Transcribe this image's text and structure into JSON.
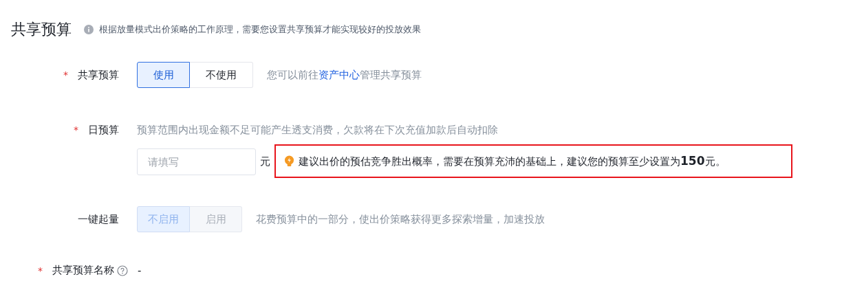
{
  "title": "共享预算",
  "title_hint": "根据放量模式出价策略的工作原理，需要您设置共享预算才能实现较好的投放效果",
  "fields": [
    {
      "kind": "segmented",
      "label": "共享预算",
      "required_mark": "*",
      "disabled": false,
      "options": [
        {
          "label": "使用",
          "selected": true
        },
        {
          "label": "不使用",
          "selected": false
        }
      ],
      "note_before": "您可以前往",
      "note_link": "资产中心",
      "note_after": "管理共享预算"
    },
    {
      "kind": "budget",
      "label": "日预算",
      "required_mark": "*",
      "hint": "预算范围内出现金额不足可能产生透支消费，欠款将在下次充值加款后自动扣除",
      "placeholder": "请填写",
      "unit": "元",
      "tip": "建议出价的预估竞争胜出概率，需要在预算充沛的基础上，建议您的预算至少设置为**150**元。"
    },
    {
      "kind": "segmented",
      "label": "一键起量",
      "disabled": true,
      "options": [
        {
          "label": "不启用",
          "selected": true
        },
        {
          "label": "启用",
          "selected": false
        }
      ],
      "note_before": "花费预算中的一部分，使出价策略获得更多探索增量，加速投放"
    },
    {
      "kind": "text",
      "label": "共享预算名称",
      "required_mark": "*",
      "help": true,
      "value": "-"
    }
  ]
}
